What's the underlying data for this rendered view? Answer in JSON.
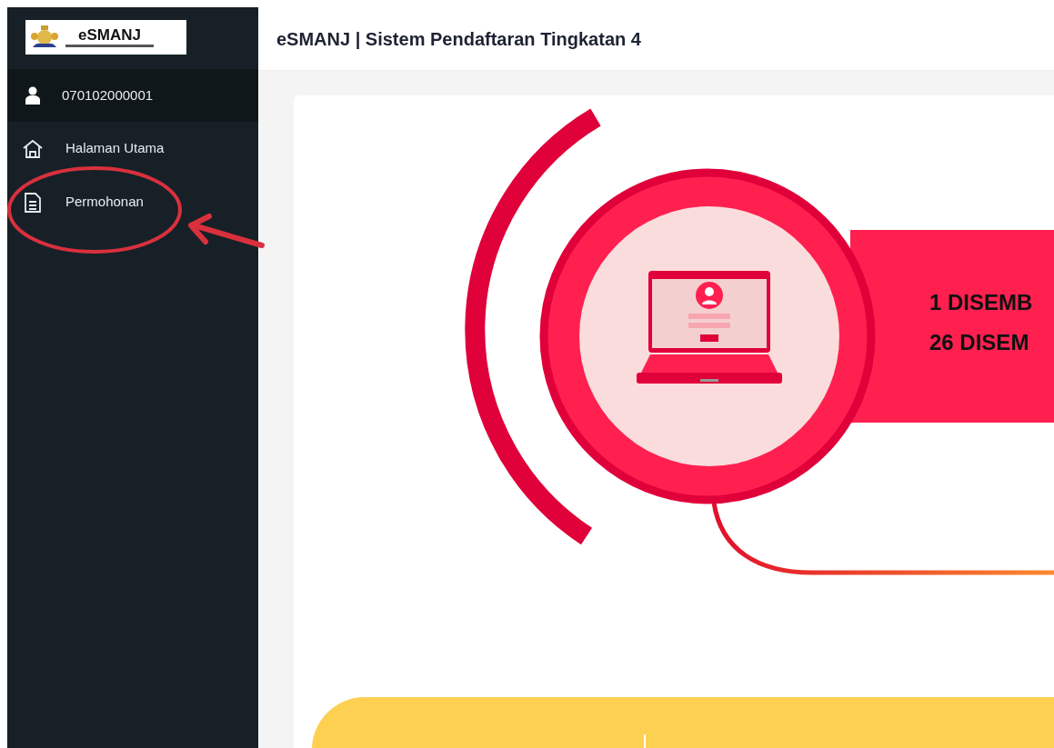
{
  "brand": {
    "title": "eSMANJ"
  },
  "user": {
    "id": "070102000001"
  },
  "nav": [
    {
      "label": "Halaman Utama",
      "kind": "home"
    },
    {
      "label": "Permohonan",
      "kind": "document"
    }
  ],
  "header": {
    "title": "eSMANJ | Sistem Pendaftaran Tingkatan 4"
  },
  "banner": {
    "lines": [
      "1 DISEMB",
      "26 DISEM"
    ]
  }
}
